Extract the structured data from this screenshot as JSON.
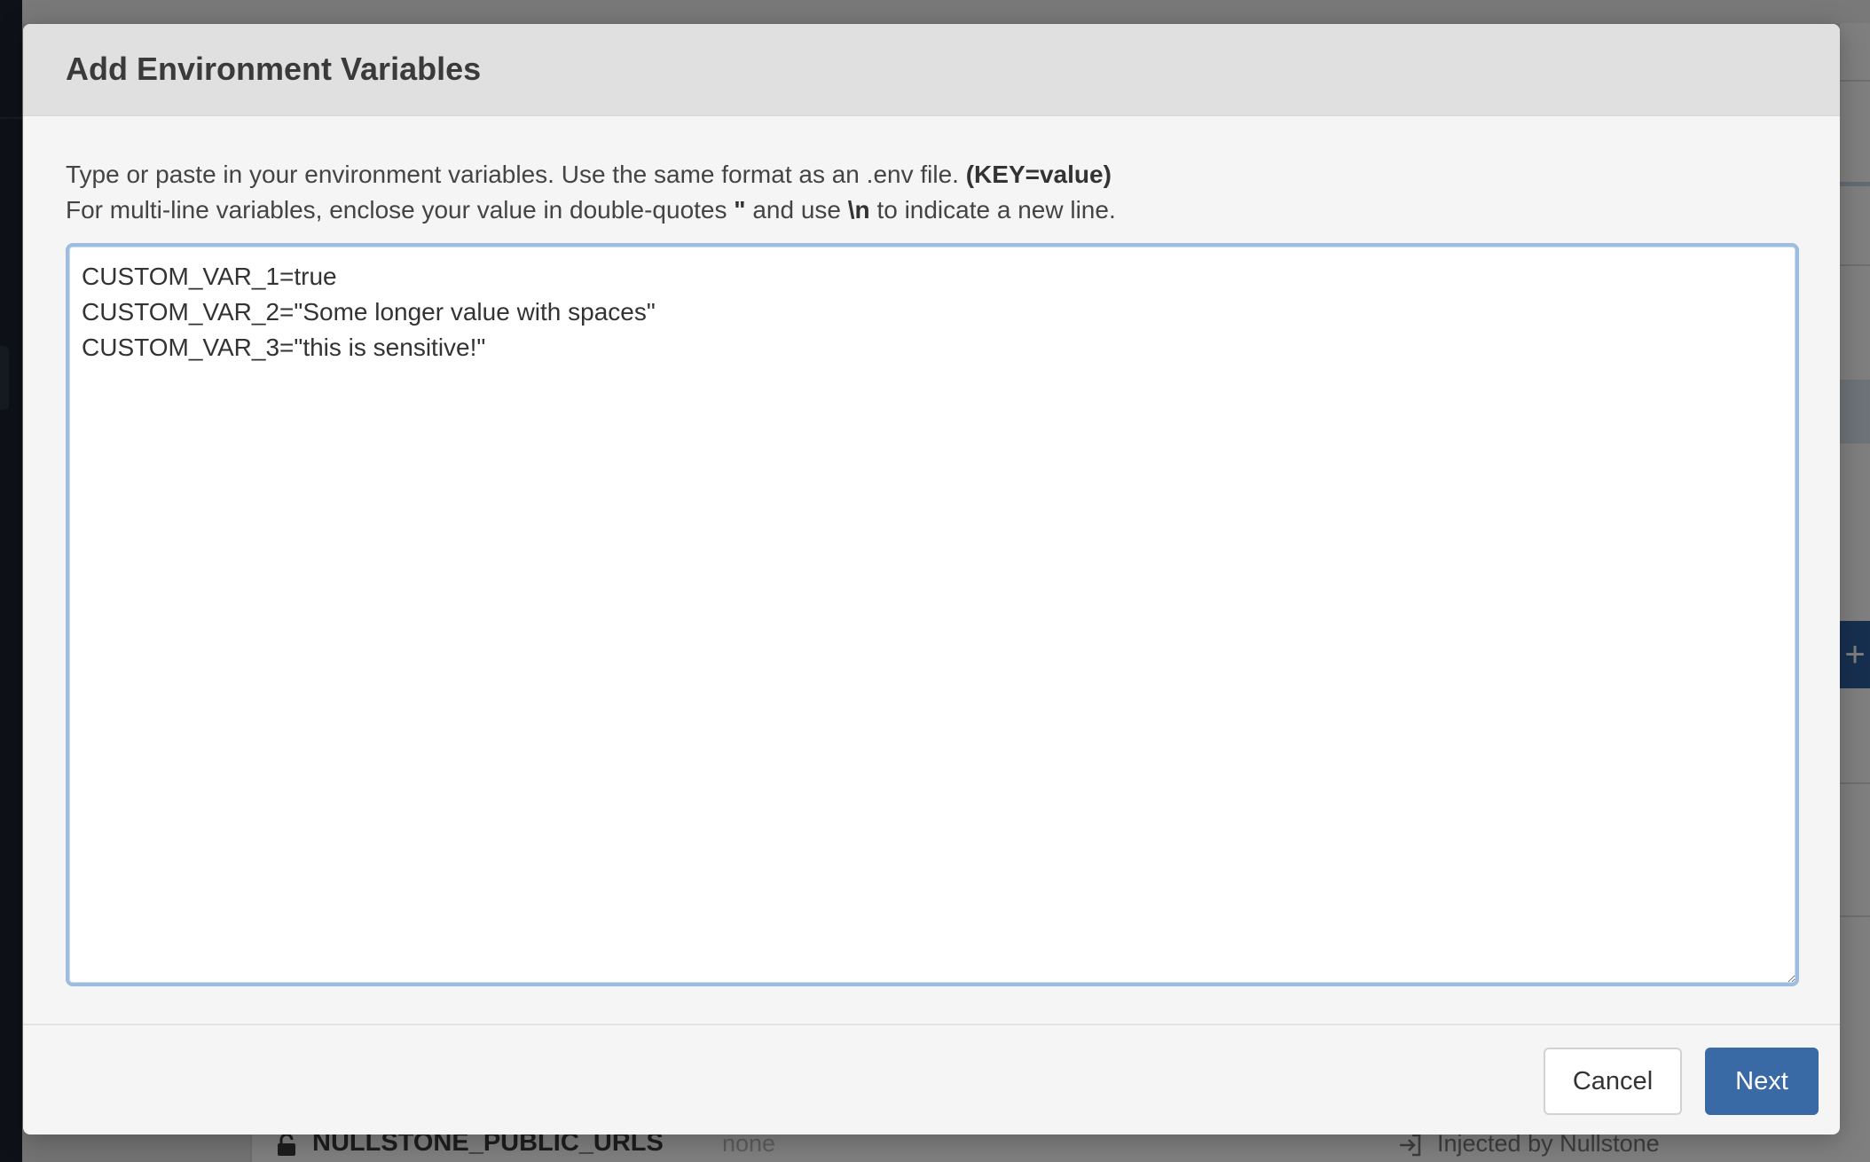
{
  "background": {
    "row_key": "NULLSTONE_PUBLIC_URLS",
    "row_value": "none",
    "row_source": "Injected by Nullstone",
    "plus_label": "+"
  },
  "modal": {
    "title": "Add Environment Variables",
    "description": {
      "line1_text": "Type or paste in your environment variables. Use the same format as an .env file.",
      "line1_format": "(KEY=value)",
      "line2_a": "For multi-line variables, enclose your value in double-quotes",
      "line2_quote": "\"",
      "line2_b": "and use",
      "line2_newline": "\\n",
      "line2_c": "to indicate a new line."
    },
    "editor_value": "CUSTOM_VAR_1=true\nCUSTOM_VAR_2=\"Some longer value with spaces\"\nCUSTOM_VAR_3=\"this is sensitive!\"",
    "buttons": {
      "cancel": "Cancel",
      "next": "Next"
    }
  },
  "colors": {
    "primary": "#3a6aa6",
    "focus_ring": "#9dbce0",
    "sidebar": "#1c2430"
  }
}
